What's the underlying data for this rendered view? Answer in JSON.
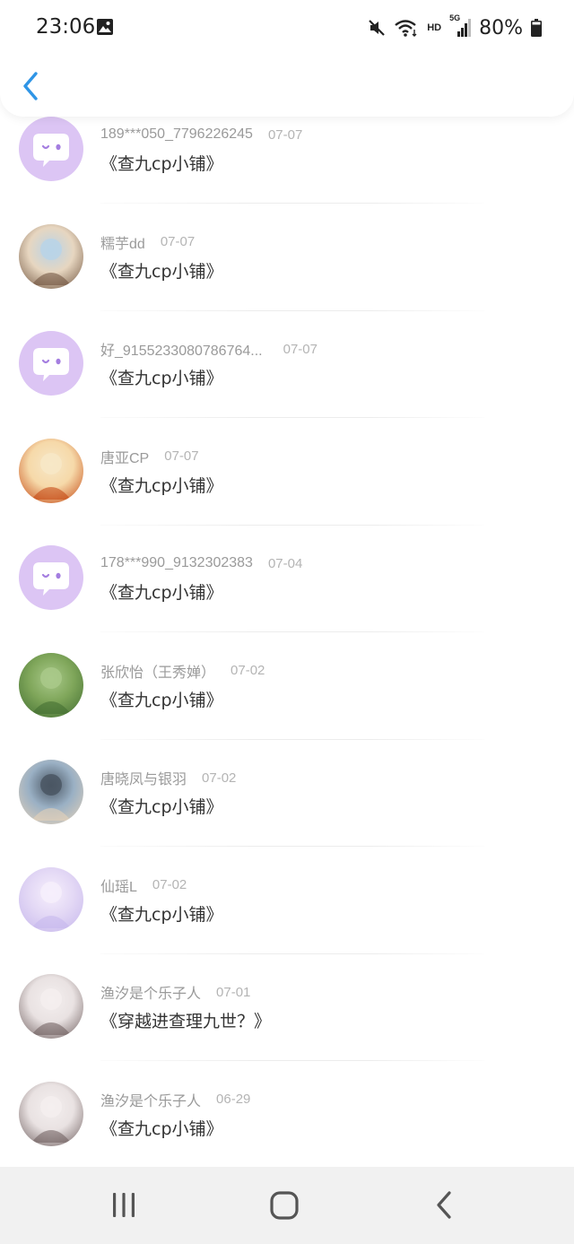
{
  "status_bar": {
    "time": "23:06",
    "network_label": "HD",
    "signal_label": "5G",
    "battery_percent": "80%",
    "icons": [
      "gallery-icon",
      "mute-icon",
      "wifi-icon",
      "signal-icon",
      "battery-icon"
    ]
  },
  "header": {
    "back_icon": "chevron-left-icon"
  },
  "messages": [
    {
      "name": "189***050_7796226245",
      "date": "07-07",
      "text": "《查九cp小铺》",
      "avatar": "default-chat-avatar"
    },
    {
      "name": "糯芋dd",
      "date": "07-07",
      "text": "《查九cp小铺》",
      "avatar": "user-photo-avatar"
    },
    {
      "name": "好_9155233080786764...",
      "date": "07-07",
      "text": "《查九cp小铺》",
      "avatar": "default-chat-avatar"
    },
    {
      "name": "唐亚CP",
      "date": "07-07",
      "text": "《查九cp小铺》",
      "avatar": "user-photo-avatar"
    },
    {
      "name": "178***990_9132302383",
      "date": "07-04",
      "text": "《查九cp小铺》",
      "avatar": "default-chat-avatar"
    },
    {
      "name": "张欣怡（王秀婵）",
      "date": "07-02",
      "text": "《查九cp小铺》",
      "avatar": "user-photo-avatar"
    },
    {
      "name": "唐晓凤与银羽",
      "date": "07-02",
      "text": "《查九cp小铺》",
      "avatar": "user-photo-avatar"
    },
    {
      "name": "仙瑶L",
      "date": "07-02",
      "text": "《查九cp小铺》",
      "avatar": "user-photo-avatar"
    },
    {
      "name": "渔汐是个乐子人",
      "date": "07-01",
      "text": "《穿越进查理九世？》",
      "avatar": "user-photo-avatar"
    },
    {
      "name": "渔汐是个乐子人",
      "date": "06-29",
      "text": "《查九cp小铺》",
      "avatar": "user-photo-avatar"
    }
  ],
  "nav_bar": {
    "icons": [
      "recent-apps-icon",
      "home-icon",
      "back-icon"
    ]
  },
  "colors": {
    "accent": "#2f95e6",
    "default_avatar_bg": "#dcc5f4",
    "default_avatar_dot": "#a47ee0"
  }
}
